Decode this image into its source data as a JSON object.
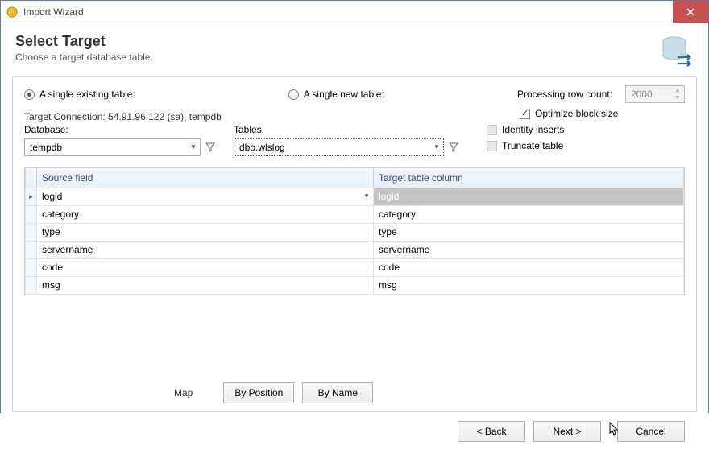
{
  "window": {
    "title": "Import Wizard"
  },
  "header": {
    "title": "Select Target",
    "subtitle": "Choose a target database table."
  },
  "options": {
    "radio_existing": "A single existing table:",
    "radio_new": "A single new table:",
    "processing_label": "Processing row count:",
    "processing_value": "2000",
    "optimize_label": "Optimize block size",
    "connection_label": "Target Connection: 54.91.96.122 (sa), tempdb",
    "database_label": "Database:",
    "database_value": "tempdb",
    "tables_label": "Tables:",
    "tables_value": "dbo.wlslog",
    "identity_label": "Identity inserts",
    "truncate_label": "Truncate table"
  },
  "grid": {
    "head_source": "Source field",
    "head_target": "Target table column",
    "rows": [
      {
        "source": "logid",
        "target": "logid",
        "selected": true
      },
      {
        "source": "category",
        "target": "category"
      },
      {
        "source": "type",
        "target": "type"
      },
      {
        "source": "servername",
        "target": "servername"
      },
      {
        "source": "code",
        "target": "code"
      },
      {
        "source": "msg",
        "target": "msg"
      }
    ]
  },
  "map": {
    "label": "Map",
    "by_position": "By Position",
    "by_name": "By Name"
  },
  "footer": {
    "back": "< Back",
    "next": "Next >",
    "cancel": "Cancel"
  }
}
